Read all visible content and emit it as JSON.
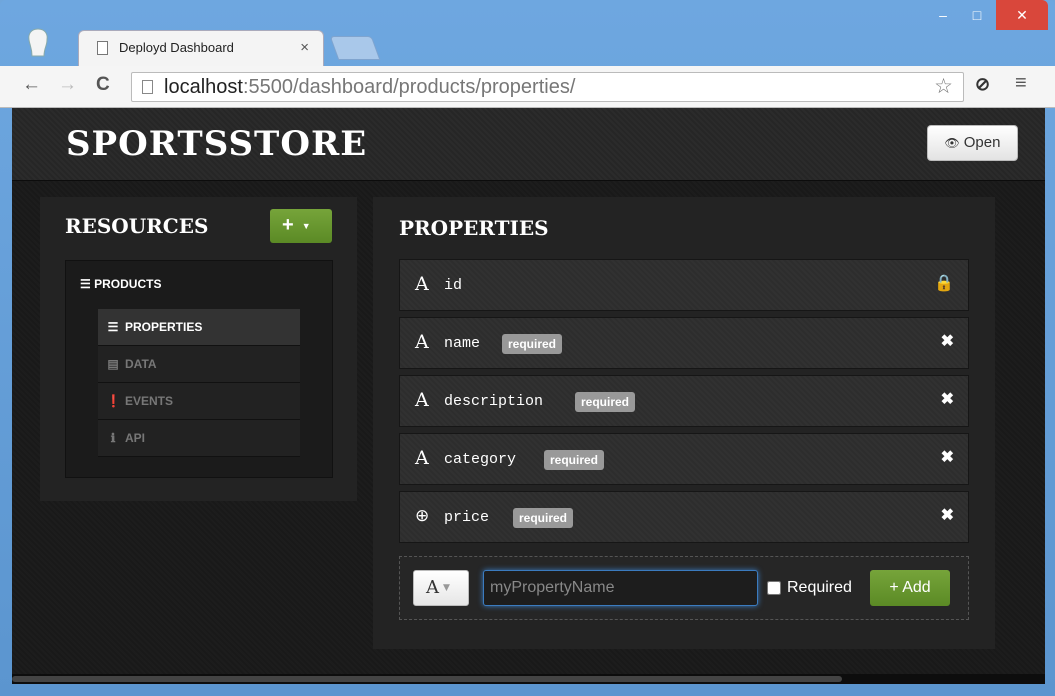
{
  "browser": {
    "tab_title": "Deployd Dashboard",
    "tab_close": "×",
    "url_host": "localhost",
    "url_rest": ":5500/dashboard/products/properties/",
    "window_min": "–",
    "window_max": "□",
    "window_close": "✕",
    "nav_back": "←",
    "nav_forward": "→",
    "nav_reload": "C",
    "star": "☆",
    "menu": "≡",
    "extension": "⊘"
  },
  "header": {
    "brand": "SPORTSSTORE",
    "open_label": "Open",
    "open_icon": "eye-icon"
  },
  "resources": {
    "heading": "RESOURCES",
    "add_label": "+",
    "root": "PRODUCTS",
    "items": [
      {
        "label": "PROPERTIES",
        "icon": "list-icon",
        "active": true
      },
      {
        "label": "DATA",
        "icon": "table-icon",
        "active": false
      },
      {
        "label": "EVENTS",
        "icon": "exclamation-icon",
        "active": false
      },
      {
        "label": "API",
        "icon": "info-icon",
        "active": false
      }
    ]
  },
  "properties": {
    "heading": "PROPERTIES",
    "rows": [
      {
        "type": "A",
        "name": "id",
        "badge": "",
        "action": "lock-icon"
      },
      {
        "type": "A",
        "name": "name",
        "badge": "required",
        "action": "delete-icon"
      },
      {
        "type": "A",
        "name": "description",
        "badge": "required",
        "action": "delete-icon"
      },
      {
        "type": "A",
        "name": "category",
        "badge": "required",
        "action": "delete-icon"
      },
      {
        "type": "⊕",
        "name": "price",
        "badge": "required",
        "action": "delete-icon"
      }
    ]
  },
  "new_property": {
    "type_label": "A",
    "name_placeholder": "myPropertyName",
    "name_value": "",
    "required_label": "Required",
    "required_checked": false,
    "add_label": "+ Add"
  }
}
